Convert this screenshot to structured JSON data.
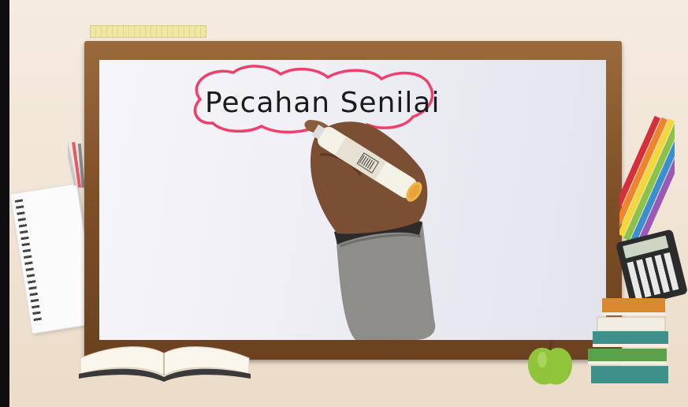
{
  "video": {
    "handwritten_title": "Pecahan Senilai"
  },
  "colors": {
    "frame": "#7d4f27",
    "board": "#f2f2f7",
    "cloud_outline": "#ef3f6c",
    "ink": "#1b1b1b"
  }
}
